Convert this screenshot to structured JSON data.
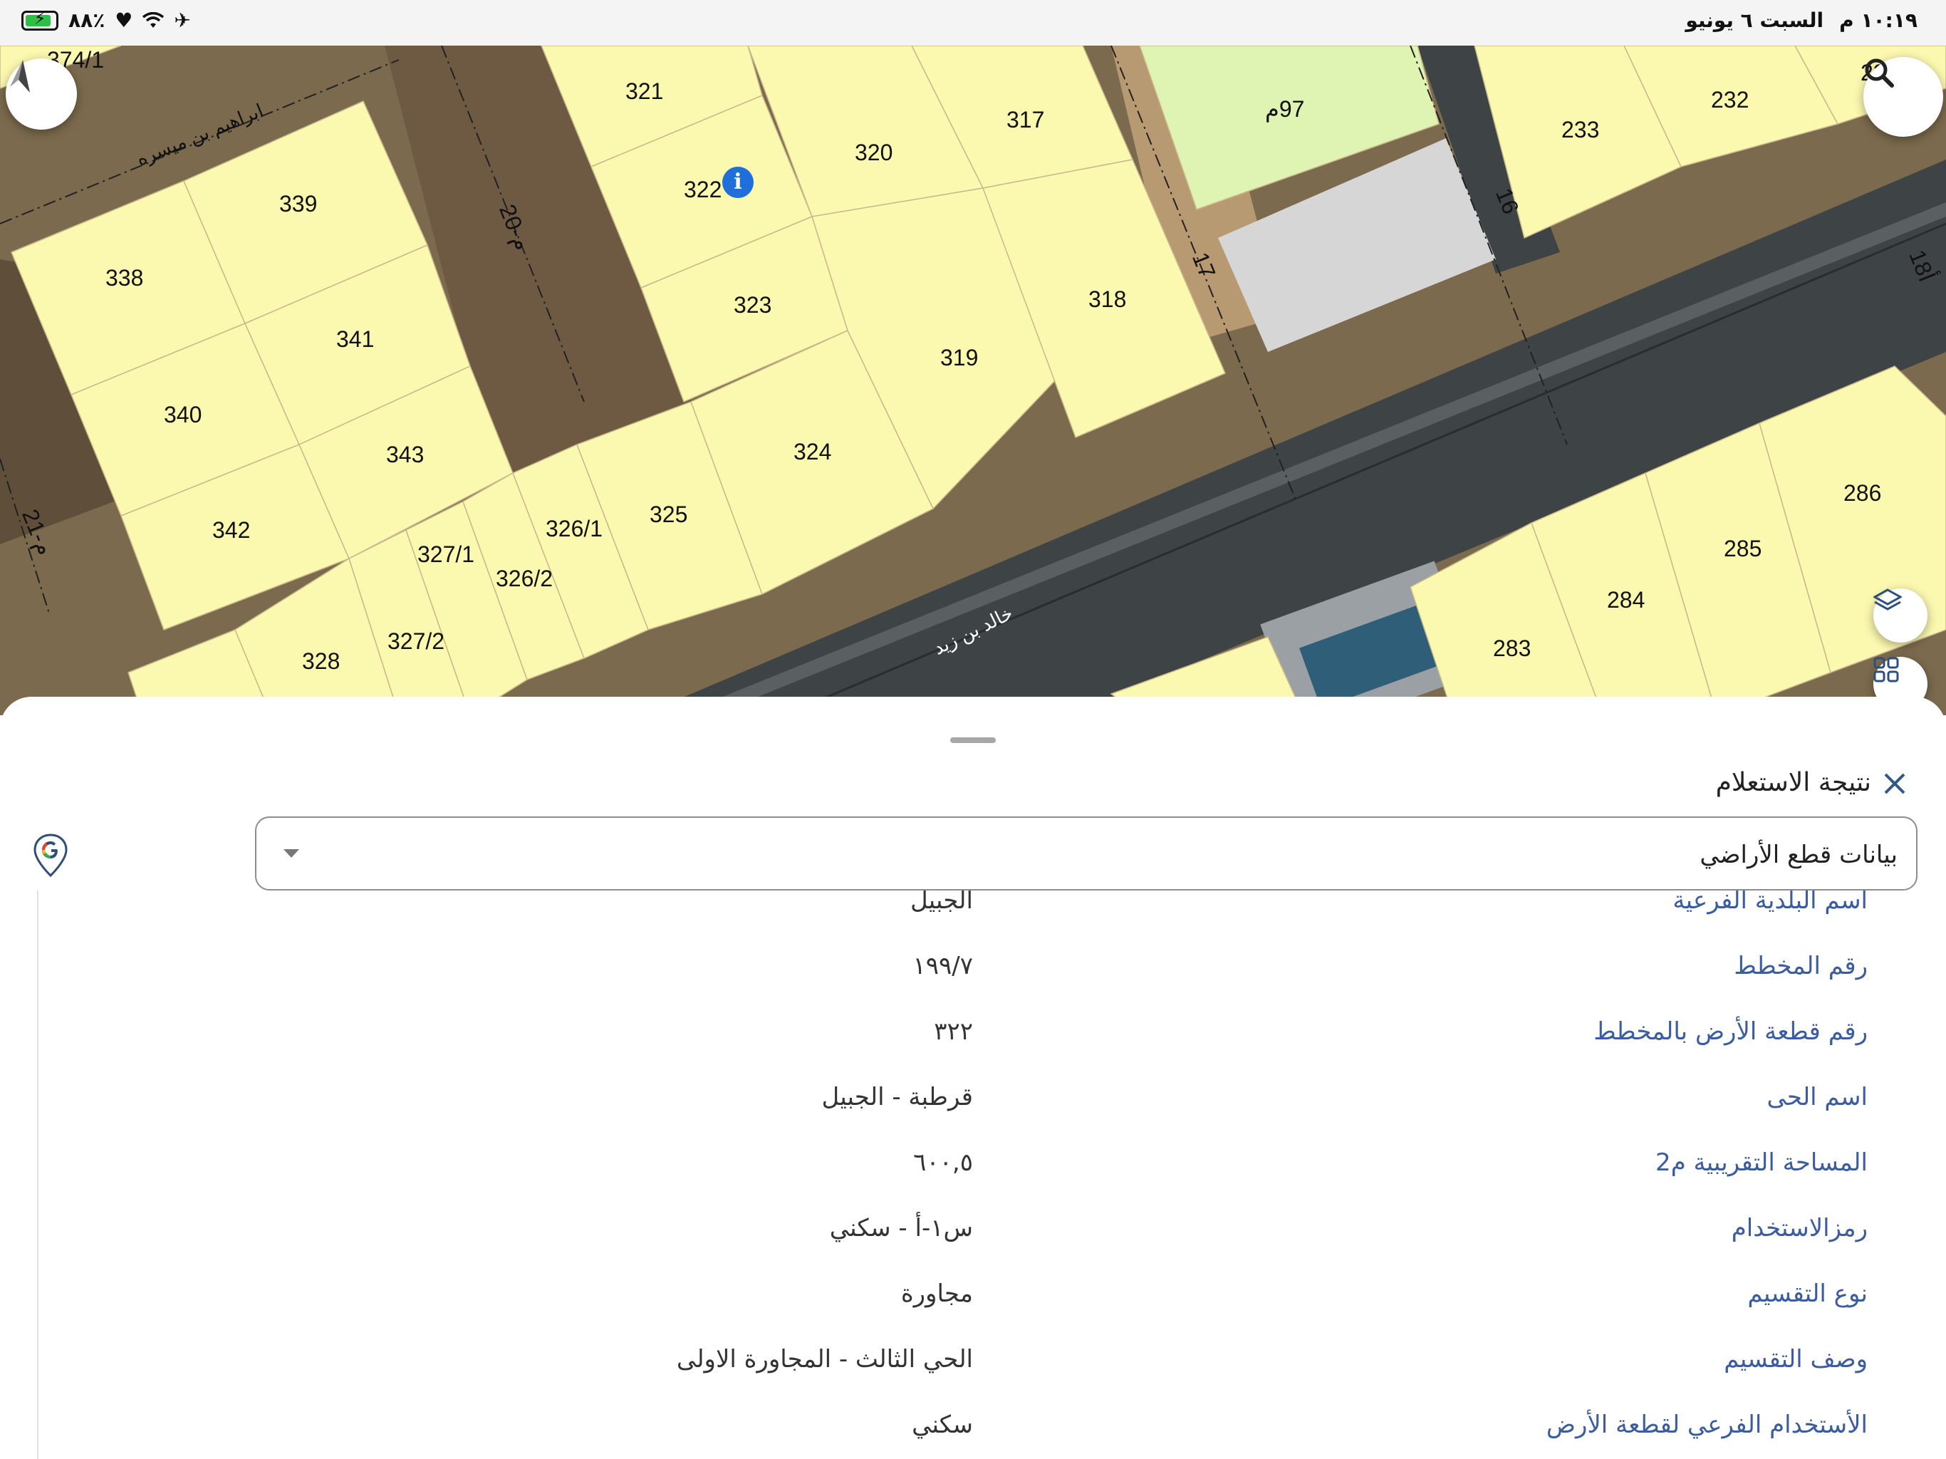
{
  "status_bar": {
    "time": "١٠:١٩ م",
    "date": "السبت ٦ يونيو",
    "battery": "٨٨٪",
    "battery_level": 0.88
  },
  "map": {
    "parcels": [
      {
        "id": "p321",
        "label": "321"
      },
      {
        "id": "p322",
        "label": "322"
      },
      {
        "id": "p320",
        "label": "320"
      },
      {
        "id": "p317",
        "label": "317"
      },
      {
        "id": "p323",
        "label": "323"
      },
      {
        "id": "p319",
        "label": "319"
      },
      {
        "id": "p318",
        "label": "318"
      },
      {
        "id": "p324",
        "label": "324"
      },
      {
        "id": "p325",
        "label": "325"
      },
      {
        "id": "p3261",
        "label": "326/1"
      },
      {
        "id": "p3262",
        "label": "326/2"
      },
      {
        "id": "p3271",
        "label": "327/1"
      },
      {
        "id": "p3272",
        "label": "327/2"
      },
      {
        "id": "p328",
        "label": "328"
      },
      {
        "id": "p338",
        "label": "338"
      },
      {
        "id": "p339",
        "label": "339"
      },
      {
        "id": "p340",
        "label": "340"
      },
      {
        "id": "p341",
        "label": "341"
      },
      {
        "id": "p342",
        "label": "342"
      },
      {
        "id": "p343",
        "label": "343"
      },
      {
        "id": "p233",
        "label": "233"
      },
      {
        "id": "p232",
        "label": "232"
      },
      {
        "id": "p231",
        "label": "231"
      },
      {
        "id": "p283",
        "label": "283"
      },
      {
        "id": "p284",
        "label": "284"
      },
      {
        "id": "p285",
        "label": "285"
      },
      {
        "id": "p286",
        "label": "286"
      },
      {
        "id": "p3741",
        "label": "374/1"
      },
      {
        "id": "p97",
        "label": "97م"
      }
    ],
    "road_labels": {
      "r16": "16",
      "r17": "17",
      "r18": "18أ",
      "r20": "20-م",
      "r21": "21-م",
      "street_ibrahim": "ابراهيم بن ميسره",
      "street_khalid": "خالد بن زيد"
    },
    "accent": "#1e6fd9"
  },
  "sheet": {
    "title": "نتيجة الاستعلام",
    "layer_value": "بيانات قطع الأراضي",
    "rows": [
      {
        "label": "اسم البلدية الفرعية",
        "value": "الجبيل"
      },
      {
        "label": "رقم المخطط",
        "value": "١٩٩/٧"
      },
      {
        "label": "رقم قطعة الأرض بالمخطط",
        "value": "٣٢٢"
      },
      {
        "label": "اسم الحى",
        "value": "قرطبة - الجبيل"
      },
      {
        "label": "المساحة التقريبية م2",
        "value": "٦٠٠,٥"
      },
      {
        "label": "رمزالاستخدام",
        "value": "س١-أ - سكني"
      },
      {
        "label": "نوع التقسيم",
        "value": "مجاورة"
      },
      {
        "label": "وصف التقسيم",
        "value": "الحي الثالث - المجاورة الاولى"
      },
      {
        "label": "الأستخدام الفرعي لقطعة الأرض",
        "value": "سكني"
      }
    ]
  }
}
